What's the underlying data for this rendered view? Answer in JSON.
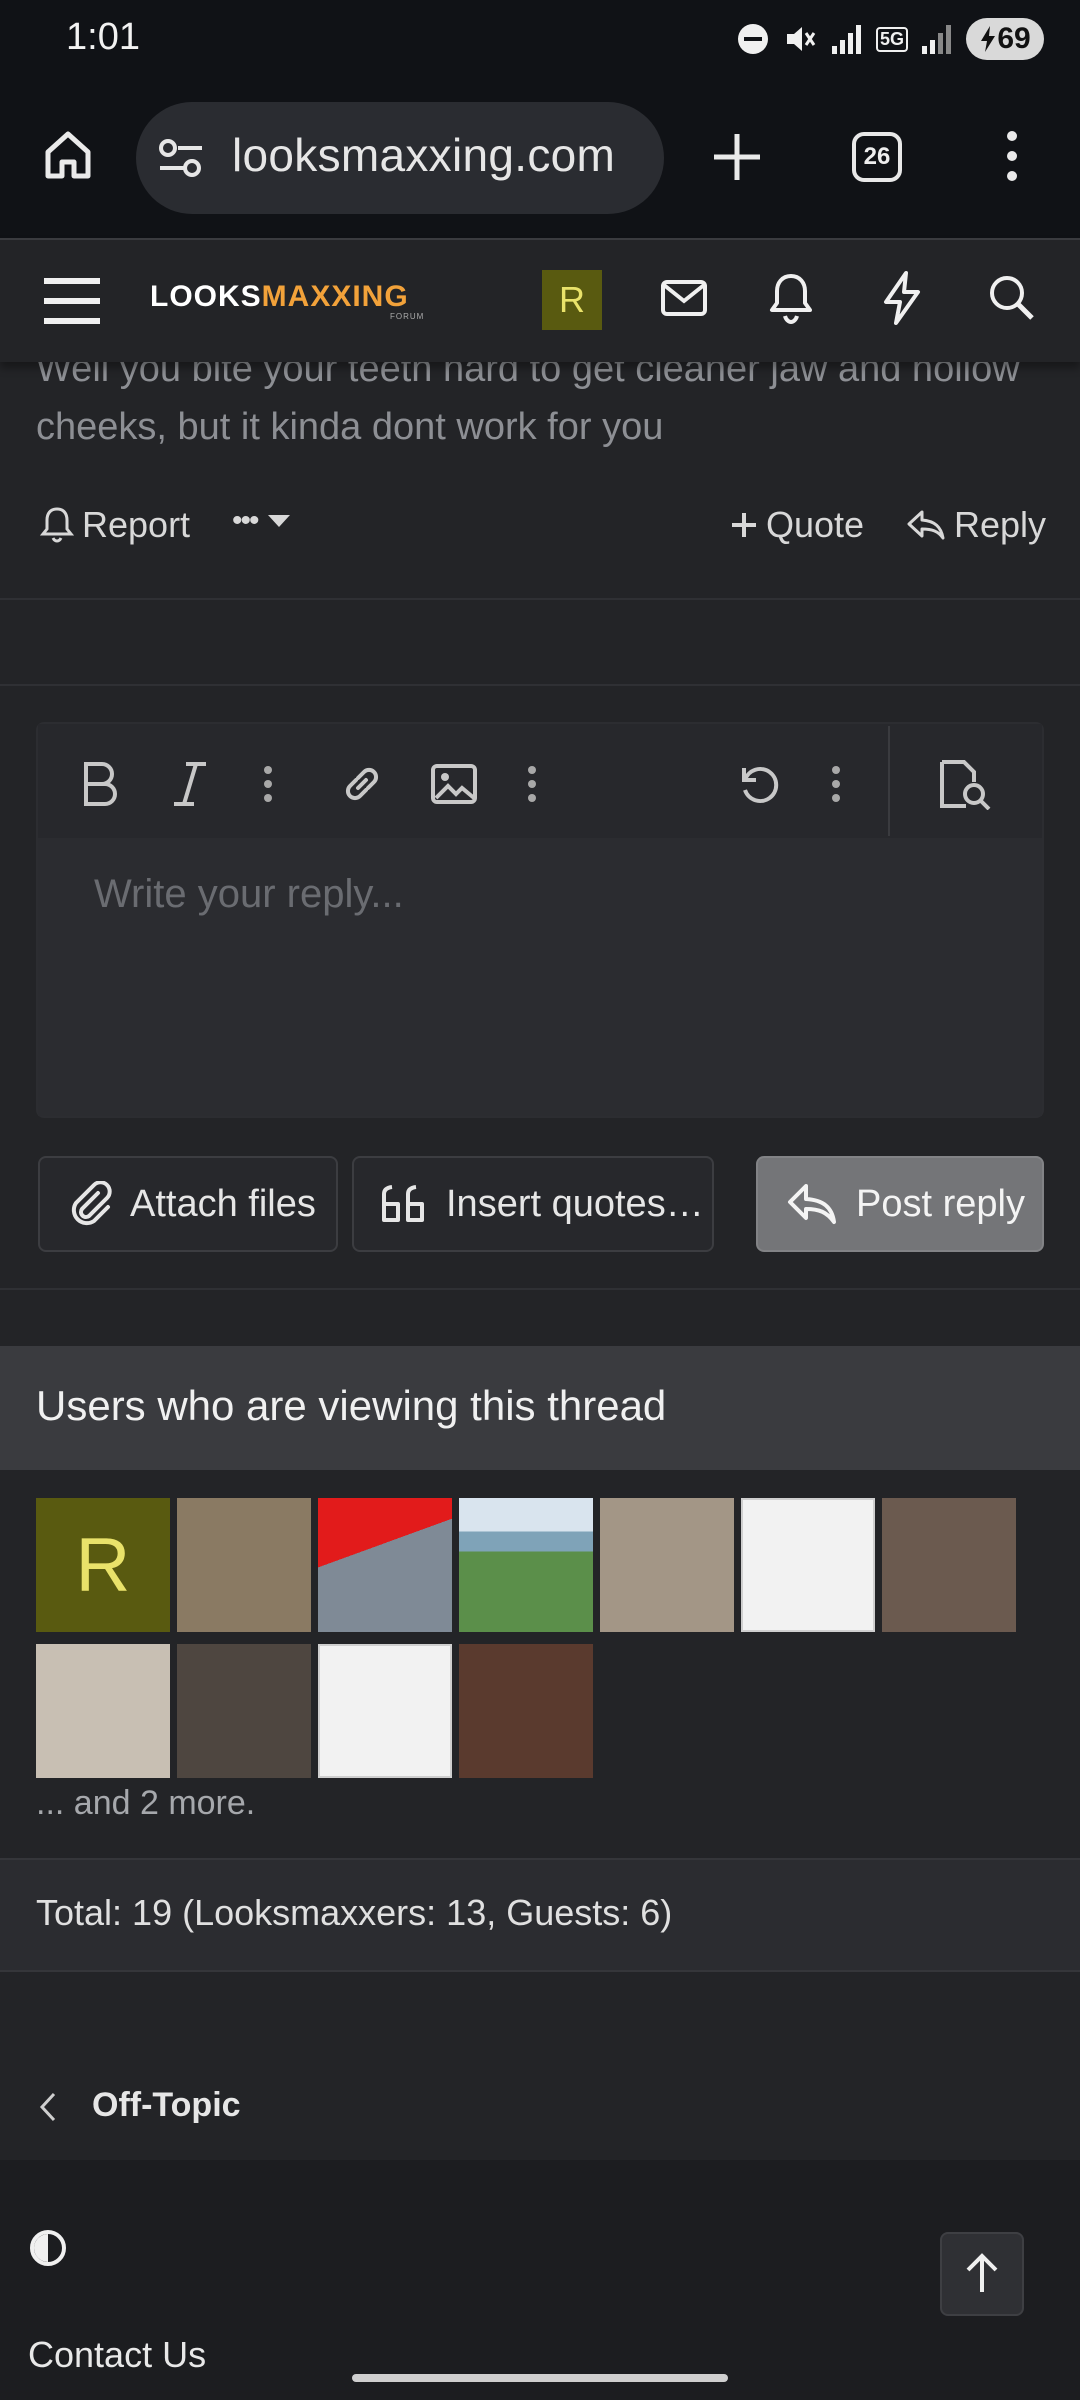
{
  "status_bar": {
    "time": "1:01",
    "network": "5G",
    "battery": "69"
  },
  "browser": {
    "url": "looksmaxxing.com",
    "tab_count": "26"
  },
  "site": {
    "logo_white": "LOOKS",
    "logo_orange": "MAXXING",
    "logo_sub": "FORUM",
    "avatar_letter": "R"
  },
  "post": {
    "text": "Well you bite your teeth hard to get cleaner jaw and hollow cheeks, but it kinda dont work for you",
    "report_label": "Report",
    "more_label": "•••",
    "quote_label": "Quote",
    "reply_label": "Reply"
  },
  "editor": {
    "placeholder": "Write your reply...",
    "attach_label": "Attach files",
    "insert_quotes_label": "Insert quotes…",
    "post_reply_label": "Post reply"
  },
  "viewers": {
    "title": "Users who are viewing this thread",
    "avatars": [
      {
        "kind": "letter",
        "letter": "R",
        "color": "#595a10"
      },
      {
        "kind": "cartoon-blonde",
        "color": "#8a7a63"
      },
      {
        "kind": "red-laser-man",
        "color": "#7f8a96"
      },
      {
        "kind": "mountain-valley",
        "color": "#6f9a5c"
      },
      {
        "kind": "pink-hair-man",
        "color": "#a39686"
      },
      {
        "kind": "sketch-portrait",
        "color": "#e8e8e8"
      },
      {
        "kind": "woman-brown-hair",
        "color": "#6b5a4f"
      },
      {
        "kind": "floral-dress",
        "color": "#c8bfb3"
      },
      {
        "kind": "curly-hair",
        "color": "#4e4640"
      },
      {
        "kind": "winged-statue",
        "color": "#ededed"
      },
      {
        "kind": "woman-dark-hair",
        "color": "#5a3a2e"
      }
    ],
    "and_more": "... and 2 more.",
    "total": "Total: 19 (Looksmaxxers: 13, Guests: 6)"
  },
  "breadcrumb": {
    "label": "Off-Topic"
  },
  "footer": {
    "contact": "Contact Us"
  }
}
